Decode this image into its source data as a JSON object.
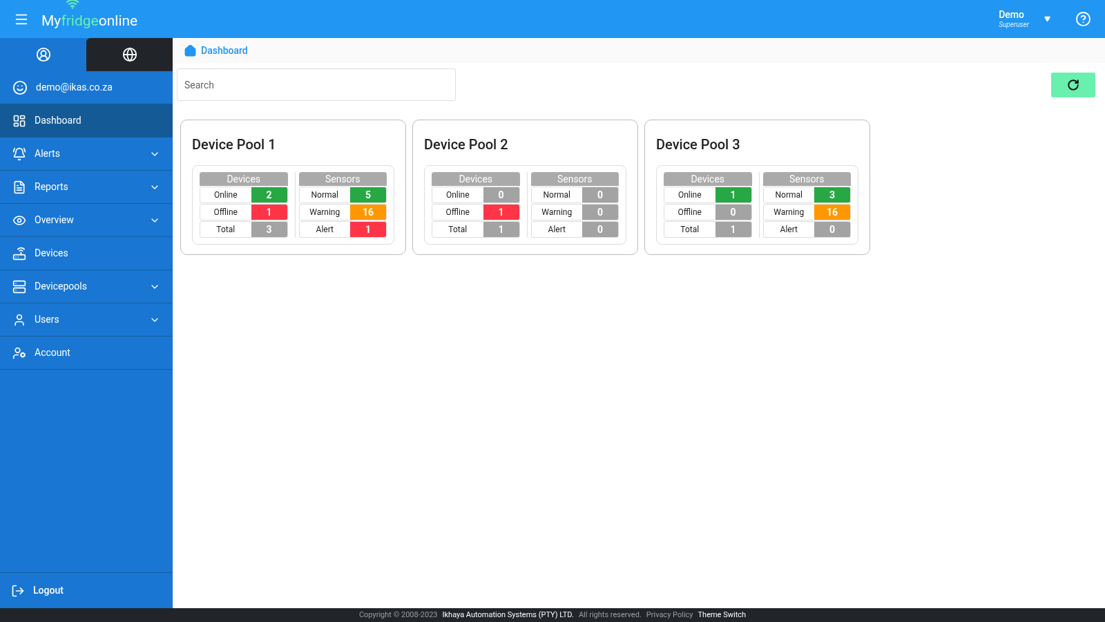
{
  "header": {
    "logo": {
      "prefix": "My",
      "highlight": "fridge",
      "suffix": "online"
    },
    "user": {
      "name": "Demo",
      "role": "Superuser"
    }
  },
  "sidebar": {
    "tabs": [
      {
        "kind": "profile",
        "selected": true
      },
      {
        "kind": "globe",
        "selected": false
      }
    ],
    "account": "demo@ikas.co.za",
    "items": [
      {
        "label": "Dashboard",
        "selected": true,
        "expandable": false
      },
      {
        "label": "Alerts",
        "selected": false,
        "expandable": true
      },
      {
        "label": "Reports",
        "selected": false,
        "expandable": true
      },
      {
        "label": "Overview",
        "selected": false,
        "expandable": true
      },
      {
        "label": "Devices",
        "selected": false,
        "expandable": false
      },
      {
        "label": "Devicepools",
        "selected": false,
        "expandable": true
      },
      {
        "label": "Users",
        "selected": false,
        "expandable": true
      },
      {
        "label": "Account",
        "selected": false,
        "expandable": false
      }
    ],
    "logout": "Logout"
  },
  "breadcrumb": "Dashboard",
  "search": {
    "placeholder": "Search"
  },
  "pools": [
    {
      "title": "Device Pool 1",
      "groups": [
        {
          "heading": "Devices",
          "rows": [
            {
              "label": "Online",
              "value": "2",
              "color": "#28a745"
            },
            {
              "label": "Offline",
              "value": "1",
              "color": "#ff3547"
            },
            {
              "label": "Total",
              "value": "3",
              "color": "#a3a3a3"
            }
          ]
        },
        {
          "heading": "Sensors",
          "rows": [
            {
              "label": "Normal",
              "value": "5",
              "color": "#28a745"
            },
            {
              "label": "Warning",
              "value": "16",
              "color": "#ff9800"
            },
            {
              "label": "Alert",
              "value": "1",
              "color": "#ff3547"
            }
          ]
        }
      ]
    },
    {
      "title": "Device Pool 2",
      "groups": [
        {
          "heading": "Devices",
          "rows": [
            {
              "label": "Online",
              "value": "0",
              "color": "#a3a3a3"
            },
            {
              "label": "Offline",
              "value": "1",
              "color": "#ff3547"
            },
            {
              "label": "Total",
              "value": "1",
              "color": "#a3a3a3"
            }
          ]
        },
        {
          "heading": "Sensors",
          "rows": [
            {
              "label": "Normal",
              "value": "0",
              "color": "#a3a3a3"
            },
            {
              "label": "Warning",
              "value": "0",
              "color": "#a3a3a3"
            },
            {
              "label": "Alert",
              "value": "0",
              "color": "#a3a3a3"
            }
          ]
        }
      ]
    },
    {
      "title": "Device Pool 3",
      "groups": [
        {
          "heading": "Devices",
          "rows": [
            {
              "label": "Online",
              "value": "1",
              "color": "#28a745"
            },
            {
              "label": "Offline",
              "value": "0",
              "color": "#a3a3a3"
            },
            {
              "label": "Total",
              "value": "1",
              "color": "#a3a3a3"
            }
          ]
        },
        {
          "heading": "Sensors",
          "rows": [
            {
              "label": "Normal",
              "value": "3",
              "color": "#28a745"
            },
            {
              "label": "Warning",
              "value": "16",
              "color": "#ff9800"
            },
            {
              "label": "Alert",
              "value": "0",
              "color": "#a3a3a3"
            }
          ]
        }
      ]
    }
  ],
  "footer": [
    {
      "kind": "muted",
      "text": "Copyright © 2008-2023"
    },
    {
      "kind": "strong",
      "text": "Ikhaya Automation Systems (PTY) LTD."
    },
    {
      "kind": "muted",
      "text": "All rights reserved."
    },
    {
      "kind": "link",
      "text": "Privacy Policy"
    },
    {
      "kind": "strong",
      "text": "Theme Switch"
    }
  ]
}
